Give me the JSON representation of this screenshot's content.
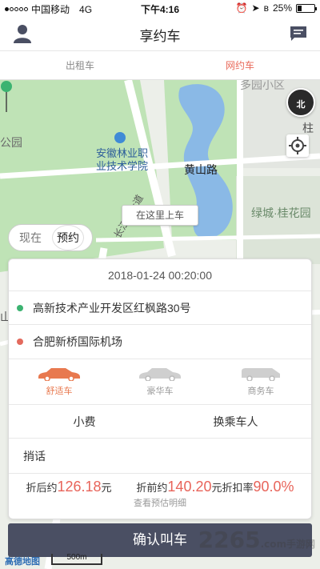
{
  "status_bar": {
    "carrier": "中国移动",
    "network": "4G",
    "time": "下午4:16",
    "battery": "25%",
    "battery_level": 0.25
  },
  "nav": {
    "title": "享约车"
  },
  "tabs": [
    {
      "label": "出租车",
      "active": false
    },
    {
      "label": "网约车",
      "active": true
    }
  ],
  "map": {
    "labels": {
      "district": "多园小区",
      "column": "柱",
      "park": "公园",
      "school": "安徽林业职\n业技术学院",
      "road": "黄山路",
      "residence": "绿城·桂花园",
      "avenue": "长江西大道",
      "edge": "山"
    },
    "compass_label": "北",
    "pickup_tip": "在这里上车",
    "scale_label": "500m",
    "logo": "高德地图"
  },
  "time_toggle": {
    "now": "现在",
    "book": "预约"
  },
  "booking": {
    "datetime": "2018-01-24 00:20:00",
    "origin": "高新技术产业开发区红枫路30号",
    "destination": "合肥新桥国际机场",
    "car_types": [
      {
        "label": "舒适车",
        "active": true
      },
      {
        "label": "豪华车",
        "active": false
      },
      {
        "label": "商务车",
        "active": false
      }
    ],
    "options": {
      "tip": "小费",
      "change_passenger": "换乘车人"
    },
    "message_label": "捎话",
    "prices": {
      "after_discount_label": "折后约",
      "after_discount_value": "126.18",
      "before_discount_label": "折前约",
      "before_discount_value": "140.20",
      "discount_label": "折扣率",
      "discount_value": "90.0%",
      "unit": "元",
      "detail_link": "查看预估明细"
    }
  },
  "confirm_button": "确认叫车",
  "watermark": {
    "text": "2265",
    "suffix": ".com",
    "sub": "手游网"
  },
  "colors": {
    "accent": "#e96a5a",
    "confirm": "#4a4f63",
    "active_car": "#e8794f",
    "green_dot": "#3cb371",
    "red_dot": "#e36a5d"
  }
}
